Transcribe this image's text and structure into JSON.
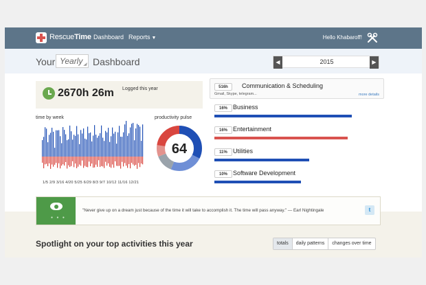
{
  "nav": {
    "logo_part1": "Rescue",
    "logo_part2": "Time",
    "dashboard": "Dashboard",
    "reports": "Reports",
    "greeting": "Hello Khabaroff!"
  },
  "header": {
    "your": "Your",
    "period": "Yearly",
    "dashboard": "Dashboard",
    "year": "2015"
  },
  "summary": {
    "hours": "2670h 26m",
    "label": "Logged this year"
  },
  "time_by_week": {
    "label": "time by week",
    "axis": "1/5   2/9   3/16  4/20  5/25  6/29   8/3    9/7  10/12 11/16 12/21"
  },
  "pulse": {
    "label": "productivity pulse",
    "score": "64"
  },
  "categories": {
    "top": {
      "badge": "516h",
      "name": "Communication & Scheduling",
      "sub": "Gmail, Skype, telegram...",
      "more": "more details"
    },
    "items": [
      {
        "pct": "16%",
        "name": "Business"
      },
      {
        "pct": "16%",
        "name": "Entertainment"
      },
      {
        "pct": "11%",
        "name": "Utilities"
      },
      {
        "pct": "10%",
        "name": "Software Development"
      }
    ]
  },
  "quote": {
    "text": "\"Never give up on a dream just because of the time it will take to accomplish it. The time will pass anyway.\" — Earl Nightingale"
  },
  "spotlight": {
    "title": "Spotlight on your top activities this year",
    "tabs": [
      "totals",
      "daily patterns",
      "changes over time"
    ]
  },
  "colors": {
    "productive": "#1f4fb5",
    "distracting": "#d9463f",
    "neutral": "#9aa3ab",
    "nav": "#5d7589"
  }
}
